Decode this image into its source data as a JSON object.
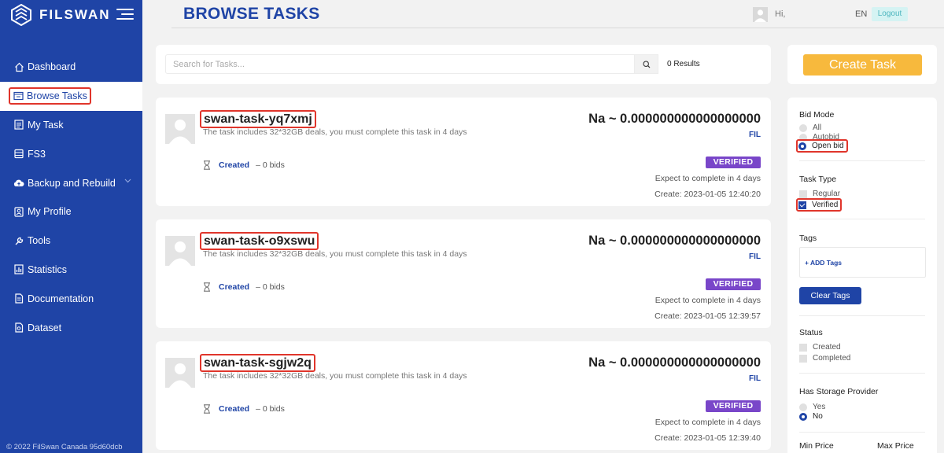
{
  "brand": {
    "name": "FILSWAN"
  },
  "sidebar": {
    "items": [
      {
        "label": "Dashboard",
        "icon": "home-icon"
      },
      {
        "label": "Browse Tasks",
        "icon": "browse-icon",
        "active": true
      },
      {
        "label": "My Task",
        "icon": "task-icon"
      },
      {
        "label": "FS3",
        "icon": "storage-icon"
      },
      {
        "label": "Backup and Rebuild",
        "icon": "cloud-upload-icon"
      },
      {
        "label": "My Profile",
        "icon": "profile-icon"
      },
      {
        "label": "Tools",
        "icon": "tools-icon"
      },
      {
        "label": "Statistics",
        "icon": "statistics-icon"
      },
      {
        "label": "Documentation",
        "icon": "documentation-icon"
      },
      {
        "label": "Dataset",
        "icon": "dataset-icon"
      }
    ],
    "footer": "© 2022 FilSwan Canada 95d60dcb"
  },
  "header": {
    "title": "BROWSE TASKS",
    "greeting": "Hi,",
    "language": "EN",
    "logout_label": "Logout"
  },
  "search": {
    "placeholder": "Search for Tasks...",
    "results": "0 Results"
  },
  "tasks": [
    {
      "name": "swan-task-yq7xmj",
      "description": "The task includes 32*32GB deals, you must complete this task in 4 days",
      "price": "Na ~ 0.000000000000000000",
      "unit": "FIL",
      "status": "Created",
      "bids": "– 0 bids",
      "badge": "VERIFIED",
      "expect": "Expect to complete in 4 days",
      "created": "Create: 2023-01-05 12:40:20"
    },
    {
      "name": "swan-task-o9xswu",
      "description": "The task includes 32*32GB deals, you must complete this task in 4 days",
      "price": "Na ~ 0.000000000000000000",
      "unit": "FIL",
      "status": "Created",
      "bids": "– 0 bids",
      "badge": "VERIFIED",
      "expect": "Expect to complete in 4 days",
      "created": "Create: 2023-01-05 12:39:57"
    },
    {
      "name": "swan-task-sgjw2q",
      "description": "The task includes 32*32GB deals, you must complete this task in 4 days",
      "price": "Na ~ 0.000000000000000000",
      "unit": "FIL",
      "status": "Created",
      "bids": "– 0 bids",
      "badge": "VERIFIED",
      "expect": "Expect to complete in 4 days",
      "created": "Create: 2023-01-05 12:39:40"
    }
  ],
  "create_task": {
    "label": "Create Task"
  },
  "filters": {
    "bid_mode": {
      "title": "Bid Mode",
      "options": [
        "All",
        "Autobid",
        "Open bid"
      ],
      "selected": "Open bid"
    },
    "task_type": {
      "title": "Task Type",
      "options": [
        "Regular",
        "Verified"
      ],
      "checked": "Verified"
    },
    "tags": {
      "title": "Tags",
      "add_label": "+ ADD Tags",
      "clear_label": "Clear Tags"
    },
    "status": {
      "title": "Status",
      "options": [
        "Created",
        "Completed"
      ]
    },
    "storage_provider": {
      "title": "Has Storage Provider",
      "options": [
        "Yes",
        "No"
      ],
      "selected": "No"
    },
    "price": {
      "min_label": "Min Price",
      "max_label": "Max Price"
    }
  },
  "colors": {
    "sidebar": "#1f44a6",
    "accent": "#1f44a6",
    "create_button": "#f7b93d",
    "badge": "#7946c9",
    "highlight": "#e0352b"
  }
}
